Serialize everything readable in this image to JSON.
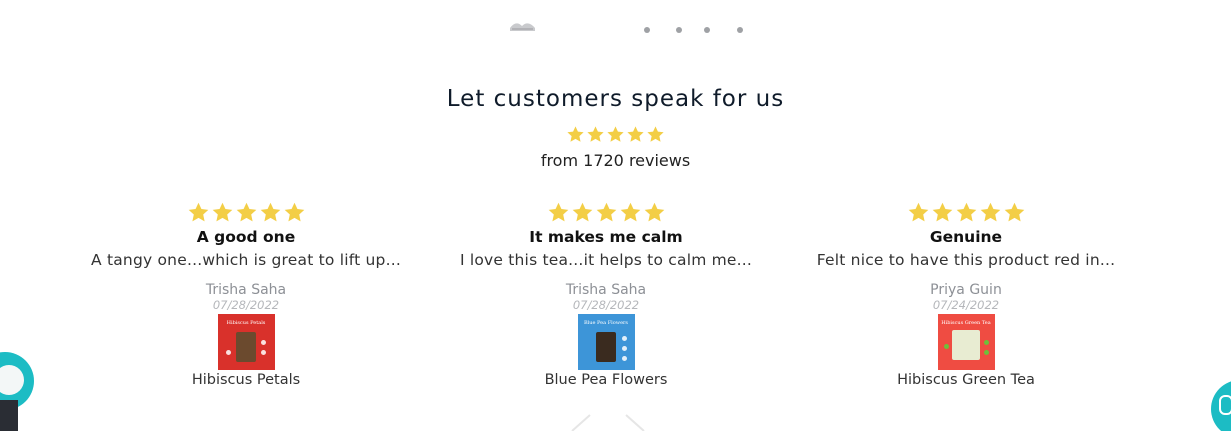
{
  "section": {
    "title": "Let customers speak for us",
    "summary_rating": 5,
    "review_count_text": "from 1720 reviews"
  },
  "colors": {
    "star": "#f3ce46",
    "accent": "#1cbcc4"
  },
  "reviews": [
    {
      "rating": 5,
      "title": "A good one",
      "body": "A tangy one...which is great to lift up...",
      "author": "Trisha Saha",
      "date": "07/28/2022",
      "product": "Hibiscus Petals",
      "thumb_label": "Hibiscus Petals"
    },
    {
      "rating": 5,
      "title": "It makes me calm",
      "body": "I love this tea...it helps to calm me...",
      "author": "Trisha Saha",
      "date": "07/28/2022",
      "product": "Blue Pea Flowers",
      "thumb_label": "Blue Pea Flowers"
    },
    {
      "rating": 5,
      "title": "Genuine",
      "body": "Felt nice to have this product red in...",
      "author": "Priya Guin",
      "date": "07/24/2022",
      "product": "Hibiscus Green Tea",
      "thumb_label": "Hibiscus Green Tea"
    }
  ],
  "icons": {
    "star": "star-icon",
    "chat": "chat-icon",
    "chevron": "chevron-down-icon"
  }
}
